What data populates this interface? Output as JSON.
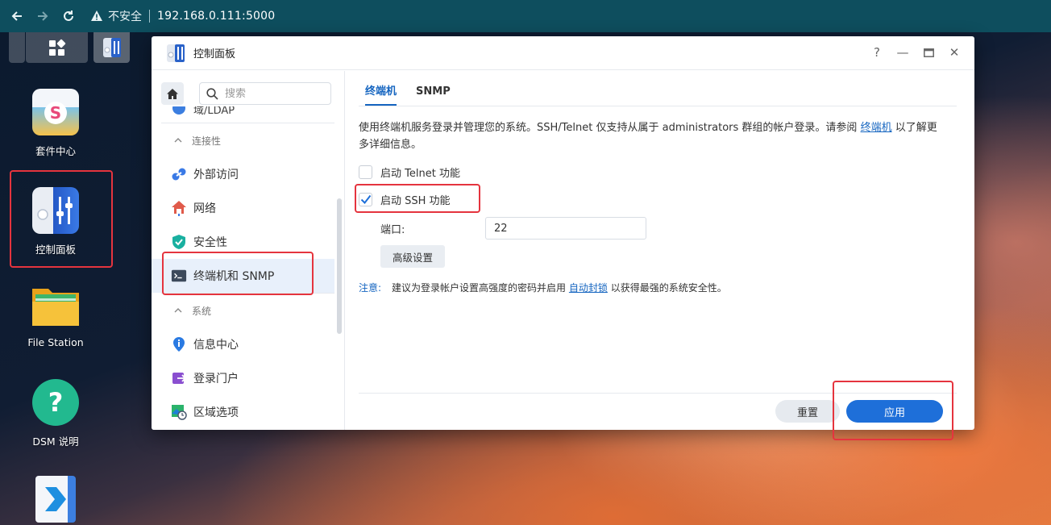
{
  "browser": {
    "security_label": "不安全",
    "url": "192.168.0.111:5000"
  },
  "desktop": {
    "icons": [
      {
        "label": "套件中心"
      },
      {
        "label": "控制面板"
      },
      {
        "label": "File Station"
      },
      {
        "label": "DSM 说明"
      },
      {
        "label": ""
      }
    ]
  },
  "window": {
    "title": "控制面板",
    "help": "?",
    "minimize": "—",
    "close": "✕"
  },
  "sidebar": {
    "search_placeholder": "搜索",
    "cut_item": "域/LDAP",
    "sections": [
      {
        "title": "连接性",
        "items": [
          {
            "label": "外部访问"
          },
          {
            "label": "网络"
          },
          {
            "label": "安全性"
          },
          {
            "label": "终端机和 SNMP",
            "active": true
          }
        ]
      },
      {
        "title": "系统",
        "items": [
          {
            "label": "信息中心"
          },
          {
            "label": "登录门户"
          },
          {
            "label": "区域选项"
          }
        ]
      }
    ]
  },
  "main": {
    "tabs": [
      {
        "label": "终端机",
        "active": true
      },
      {
        "label": "SNMP",
        "active": false
      }
    ],
    "desc_prefix": "使用终端机服务登录并管理您的系统。SSH/Telnet 仅支持从属于 administrators 群组的帐户登录。请参阅 ",
    "desc_link": "终端机",
    "desc_suffix": " 以了解更多详细信息。",
    "telnet": {
      "label": "启动 Telnet 功能",
      "checked": false
    },
    "ssh": {
      "label": "启动 SSH 功能",
      "checked": true
    },
    "port_label": "端口:",
    "port_value": "22",
    "advanced_label": "高级设置",
    "note_label": "注意:",
    "note_prefix": "建议为登录帐户设置高强度的密码并启用 ",
    "note_link": "自动封锁",
    "note_suffix": " 以获得最强的系统安全性。",
    "reset_label": "重置",
    "apply_label": "应用"
  },
  "colors": {
    "accent": "#1e6fd9",
    "highlight": "#e5343e",
    "browser_bar": "#0e4e5e"
  }
}
